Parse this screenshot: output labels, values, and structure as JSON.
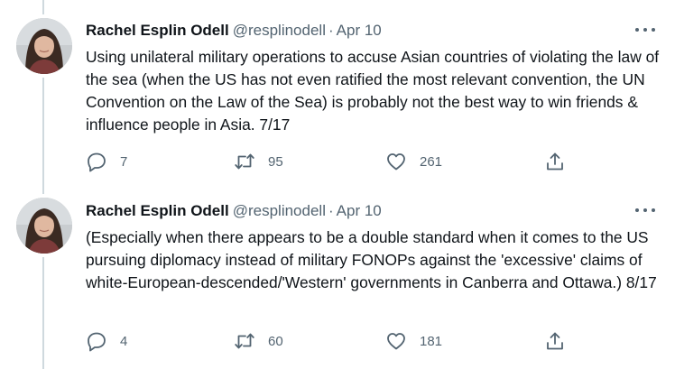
{
  "tweets": [
    {
      "author": {
        "name": "Rachel Esplin Odell",
        "handle": "@resplinodell"
      },
      "separator": "·",
      "date": "Apr 10",
      "text": "Using unilateral military operations to accuse Asian countries of violating the law of the sea (when the US has not even ratified the most relevant convention, the UN Convention on the Law of the Sea) is probably not the best way to win friends & influence people in Asia. 7/17",
      "stats": {
        "replies": "7",
        "retweets": "95",
        "likes": "261"
      }
    },
    {
      "author": {
        "name": "Rachel Esplin Odell",
        "handle": "@resplinodell"
      },
      "separator": "·",
      "date": "Apr 10",
      "text": "(Especially when there appears to be a double standard when it comes to the US pursuing diplomacy instead of military FONOPs against the 'excessive' claims of white-European-descended/'Western' governments in Canberra and Ottawa.) 8/17",
      "stats": {
        "replies": "4",
        "retweets": "60",
        "likes": "181"
      }
    }
  ],
  "icons": {
    "reply": "reply-icon",
    "retweet": "retweet-icon",
    "like": "heart-icon",
    "share": "share-icon",
    "more": "more-icon"
  },
  "colors": {
    "text": "#0f1419",
    "secondary": "#536471",
    "thread_line": "#cfd9de"
  }
}
